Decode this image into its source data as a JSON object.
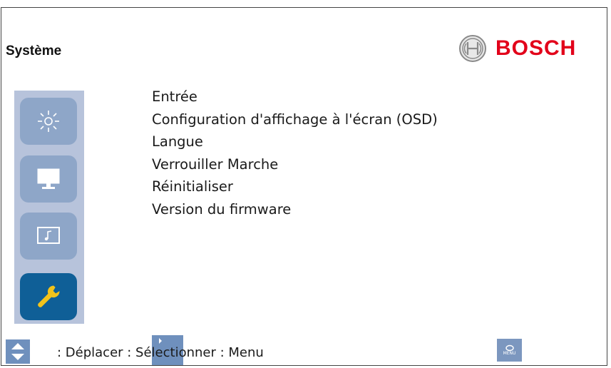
{
  "header": {
    "title": "Système",
    "brand_name": "BOSCH"
  },
  "sidebar": {
    "items": [
      {
        "icon": "brightness-icon",
        "active": false
      },
      {
        "icon": "monitor-icon",
        "active": false
      },
      {
        "icon": "audio-icon",
        "active": false
      },
      {
        "icon": "wrench-icon",
        "active": true
      }
    ]
  },
  "menu": {
    "items": [
      "Entrée",
      "Configuration d'affichage à l'écran (OSD)",
      "Langue",
      "Verrouiller Marche",
      "Réinitialiser",
      "Version du firmware"
    ]
  },
  "footer": {
    "hint_text": ": Déplacer : Sélectionner : Menu",
    "menu_key_label": "MENU"
  },
  "colors": {
    "brand_red": "#e2001a",
    "sidebar_bg": "#b7c3db",
    "button_bg": "#8ea6c8",
    "button_active_bg": "#0f5f97",
    "wrench_yellow": "#f2c31b"
  }
}
